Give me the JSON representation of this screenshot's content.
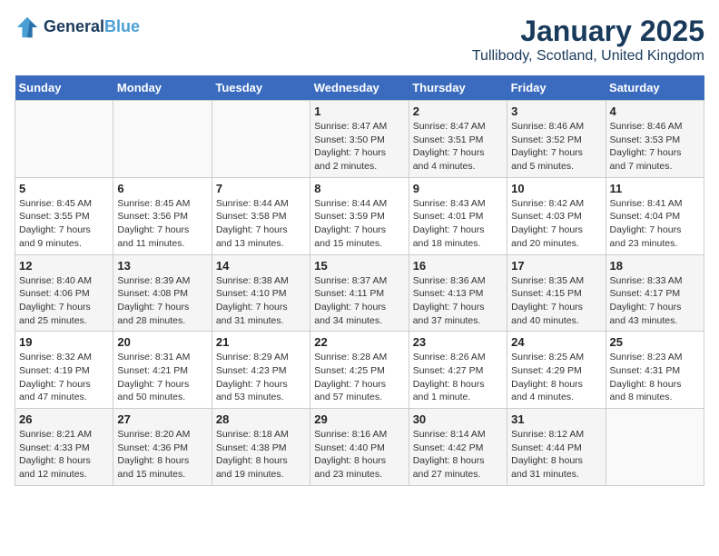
{
  "header": {
    "logo_line1": "General",
    "logo_line2": "Blue",
    "title": "January 2025",
    "subtitle": "Tullibody, Scotland, United Kingdom"
  },
  "calendar": {
    "days_of_week": [
      "Sunday",
      "Monday",
      "Tuesday",
      "Wednesday",
      "Thursday",
      "Friday",
      "Saturday"
    ],
    "weeks": [
      [
        {
          "day": "",
          "info": ""
        },
        {
          "day": "",
          "info": ""
        },
        {
          "day": "",
          "info": ""
        },
        {
          "day": "1",
          "info": "Sunrise: 8:47 AM\nSunset: 3:50 PM\nDaylight: 7 hours\nand 2 minutes."
        },
        {
          "day": "2",
          "info": "Sunrise: 8:47 AM\nSunset: 3:51 PM\nDaylight: 7 hours\nand 4 minutes."
        },
        {
          "day": "3",
          "info": "Sunrise: 8:46 AM\nSunset: 3:52 PM\nDaylight: 7 hours\nand 5 minutes."
        },
        {
          "day": "4",
          "info": "Sunrise: 8:46 AM\nSunset: 3:53 PM\nDaylight: 7 hours\nand 7 minutes."
        }
      ],
      [
        {
          "day": "5",
          "info": "Sunrise: 8:45 AM\nSunset: 3:55 PM\nDaylight: 7 hours\nand 9 minutes."
        },
        {
          "day": "6",
          "info": "Sunrise: 8:45 AM\nSunset: 3:56 PM\nDaylight: 7 hours\nand 11 minutes."
        },
        {
          "day": "7",
          "info": "Sunrise: 8:44 AM\nSunset: 3:58 PM\nDaylight: 7 hours\nand 13 minutes."
        },
        {
          "day": "8",
          "info": "Sunrise: 8:44 AM\nSunset: 3:59 PM\nDaylight: 7 hours\nand 15 minutes."
        },
        {
          "day": "9",
          "info": "Sunrise: 8:43 AM\nSunset: 4:01 PM\nDaylight: 7 hours\nand 18 minutes."
        },
        {
          "day": "10",
          "info": "Sunrise: 8:42 AM\nSunset: 4:03 PM\nDaylight: 7 hours\nand 20 minutes."
        },
        {
          "day": "11",
          "info": "Sunrise: 8:41 AM\nSunset: 4:04 PM\nDaylight: 7 hours\nand 23 minutes."
        }
      ],
      [
        {
          "day": "12",
          "info": "Sunrise: 8:40 AM\nSunset: 4:06 PM\nDaylight: 7 hours\nand 25 minutes."
        },
        {
          "day": "13",
          "info": "Sunrise: 8:39 AM\nSunset: 4:08 PM\nDaylight: 7 hours\nand 28 minutes."
        },
        {
          "day": "14",
          "info": "Sunrise: 8:38 AM\nSunset: 4:10 PM\nDaylight: 7 hours\nand 31 minutes."
        },
        {
          "day": "15",
          "info": "Sunrise: 8:37 AM\nSunset: 4:11 PM\nDaylight: 7 hours\nand 34 minutes."
        },
        {
          "day": "16",
          "info": "Sunrise: 8:36 AM\nSunset: 4:13 PM\nDaylight: 7 hours\nand 37 minutes."
        },
        {
          "day": "17",
          "info": "Sunrise: 8:35 AM\nSunset: 4:15 PM\nDaylight: 7 hours\nand 40 minutes."
        },
        {
          "day": "18",
          "info": "Sunrise: 8:33 AM\nSunset: 4:17 PM\nDaylight: 7 hours\nand 43 minutes."
        }
      ],
      [
        {
          "day": "19",
          "info": "Sunrise: 8:32 AM\nSunset: 4:19 PM\nDaylight: 7 hours\nand 47 minutes."
        },
        {
          "day": "20",
          "info": "Sunrise: 8:31 AM\nSunset: 4:21 PM\nDaylight: 7 hours\nand 50 minutes."
        },
        {
          "day": "21",
          "info": "Sunrise: 8:29 AM\nSunset: 4:23 PM\nDaylight: 7 hours\nand 53 minutes."
        },
        {
          "day": "22",
          "info": "Sunrise: 8:28 AM\nSunset: 4:25 PM\nDaylight: 7 hours\nand 57 minutes."
        },
        {
          "day": "23",
          "info": "Sunrise: 8:26 AM\nSunset: 4:27 PM\nDaylight: 8 hours\nand 1 minute."
        },
        {
          "day": "24",
          "info": "Sunrise: 8:25 AM\nSunset: 4:29 PM\nDaylight: 8 hours\nand 4 minutes."
        },
        {
          "day": "25",
          "info": "Sunrise: 8:23 AM\nSunset: 4:31 PM\nDaylight: 8 hours\nand 8 minutes."
        }
      ],
      [
        {
          "day": "26",
          "info": "Sunrise: 8:21 AM\nSunset: 4:33 PM\nDaylight: 8 hours\nand 12 minutes."
        },
        {
          "day": "27",
          "info": "Sunrise: 8:20 AM\nSunset: 4:36 PM\nDaylight: 8 hours\nand 15 minutes."
        },
        {
          "day": "28",
          "info": "Sunrise: 8:18 AM\nSunset: 4:38 PM\nDaylight: 8 hours\nand 19 minutes."
        },
        {
          "day": "29",
          "info": "Sunrise: 8:16 AM\nSunset: 4:40 PM\nDaylight: 8 hours\nand 23 minutes."
        },
        {
          "day": "30",
          "info": "Sunrise: 8:14 AM\nSunset: 4:42 PM\nDaylight: 8 hours\nand 27 minutes."
        },
        {
          "day": "31",
          "info": "Sunrise: 8:12 AM\nSunset: 4:44 PM\nDaylight: 8 hours\nand 31 minutes."
        },
        {
          "day": "",
          "info": ""
        }
      ]
    ]
  }
}
